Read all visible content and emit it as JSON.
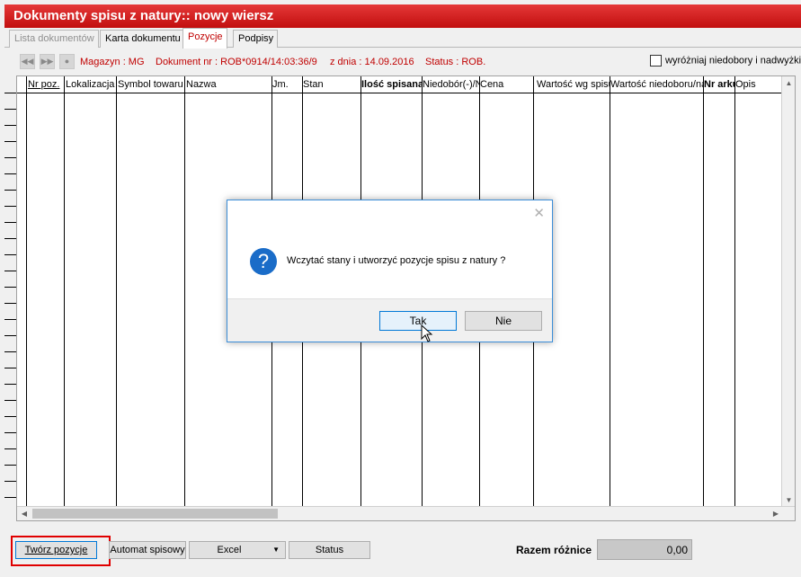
{
  "window": {
    "title": "Dokumenty spisu z natury:: nowy wiersz"
  },
  "tabs": [
    {
      "label": "Lista dokumentów",
      "state": "disabled"
    },
    {
      "label": "Karta dokumentu",
      "state": "normal"
    },
    {
      "label": "Pozycje",
      "state": "active"
    },
    {
      "label": "Podpisy",
      "state": "normal"
    }
  ],
  "infobar": {
    "magazyn": "Magazyn : MG",
    "dokument": "Dokument nr : ROB*0914/14:03:36/9",
    "data": "z dnia : 14.09.2016",
    "status": "Status : ROB.",
    "checkbox_label": "wyróżniaj niedobory i nadwyżki"
  },
  "grid": {
    "columns": [
      {
        "label": "Nr poz."
      },
      {
        "label": "Lokalizacja"
      },
      {
        "label": "Symbol towaru"
      },
      {
        "label": "Nazwa"
      },
      {
        "label": "Jm."
      },
      {
        "label": "Stan"
      },
      {
        "label": "Ilość spisana"
      },
      {
        "label": "Niedobór(-)/Nadwyżka(+)"
      },
      {
        "label": "Cena"
      },
      {
        "label": "Wartość wg spisu"
      },
      {
        "label": "Wartość niedoboru/nadwyżki"
      },
      {
        "label": "Nr arkusza"
      },
      {
        "label": "Opis"
      }
    ]
  },
  "buttons": {
    "create_positions": "Twórz pozycje",
    "auto": "Automat spisowy",
    "excel": "Excel",
    "status": "Status"
  },
  "summary": {
    "label": "Razem różnice",
    "value": "0,00"
  },
  "dialog": {
    "message": "Wczytać stany i utworzyć pozycje spisu z natury ?",
    "yes": "Tak",
    "no": "Nie"
  },
  "colors": {
    "title_bar": "#d01a1a",
    "accent_red": "#c00000",
    "dialog_border": "#3c8ed8",
    "icon_blue": "#1a6cc8"
  }
}
